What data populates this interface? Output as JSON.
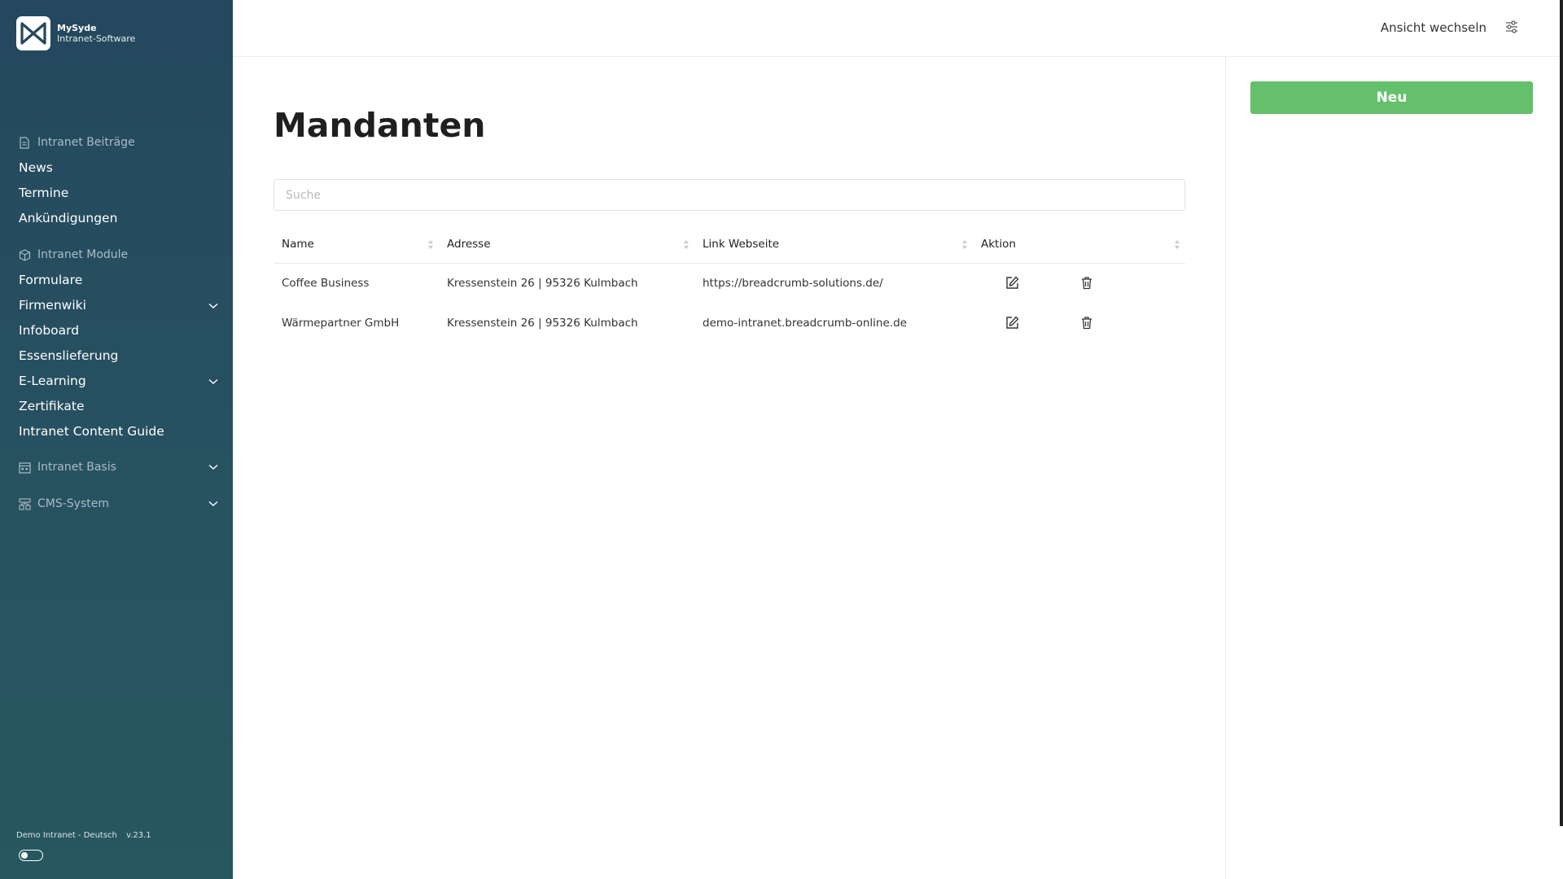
{
  "brand": {
    "name": "MySyde",
    "subtitle": "Intranet-Software"
  },
  "sidebar": {
    "sections": [
      {
        "label": "Intranet Beiträge",
        "icon": "document-icon",
        "items": [
          {
            "label": "News"
          },
          {
            "label": "Termine"
          },
          {
            "label": "Ankündigungen"
          }
        ]
      },
      {
        "label": "Intranet Module",
        "icon": "cube-icon",
        "items": [
          {
            "label": "Formulare"
          },
          {
            "label": "Firmenwiki",
            "expandable": true
          },
          {
            "label": "Infoboard"
          },
          {
            "label": "Essenslieferung"
          },
          {
            "label": "E-Learning",
            "expandable": true
          },
          {
            "label": "Zertifikate"
          },
          {
            "label": "Intranet Content Guide"
          }
        ]
      },
      {
        "label": "Intranet Basis",
        "icon": "calendar-grid-icon",
        "expandable": true
      },
      {
        "label": "CMS-System",
        "icon": "sitemap-icon",
        "expandable": true
      }
    ],
    "footer": {
      "instance": "Demo Intranet - Deutsch",
      "version": "v.23.1"
    }
  },
  "topbar": {
    "view_switch": "Ansicht wechseln",
    "settings_icon": "sliders-icon"
  },
  "main": {
    "title": "Mandanten",
    "search_placeholder": "Suche",
    "table": {
      "columns": [
        "Name",
        "Adresse",
        "Link Webseite",
        "Aktion"
      ],
      "rows": [
        {
          "name": "Coffee Business",
          "address": "Kressenstein 26 | 95326 Kulmbach",
          "link": "https://breadcrumb-solutions.de/"
        },
        {
          "name": "Wärmepartner GmbH",
          "address": "Kressenstein 26 | 95326 Kulmbach",
          "link": "demo-intranet.breadcrumb-online.de"
        }
      ]
    }
  },
  "right_panel": {
    "new_button": "Neu"
  },
  "colors": {
    "sidebar": "#24485e",
    "accent_green": "#64c06b"
  }
}
